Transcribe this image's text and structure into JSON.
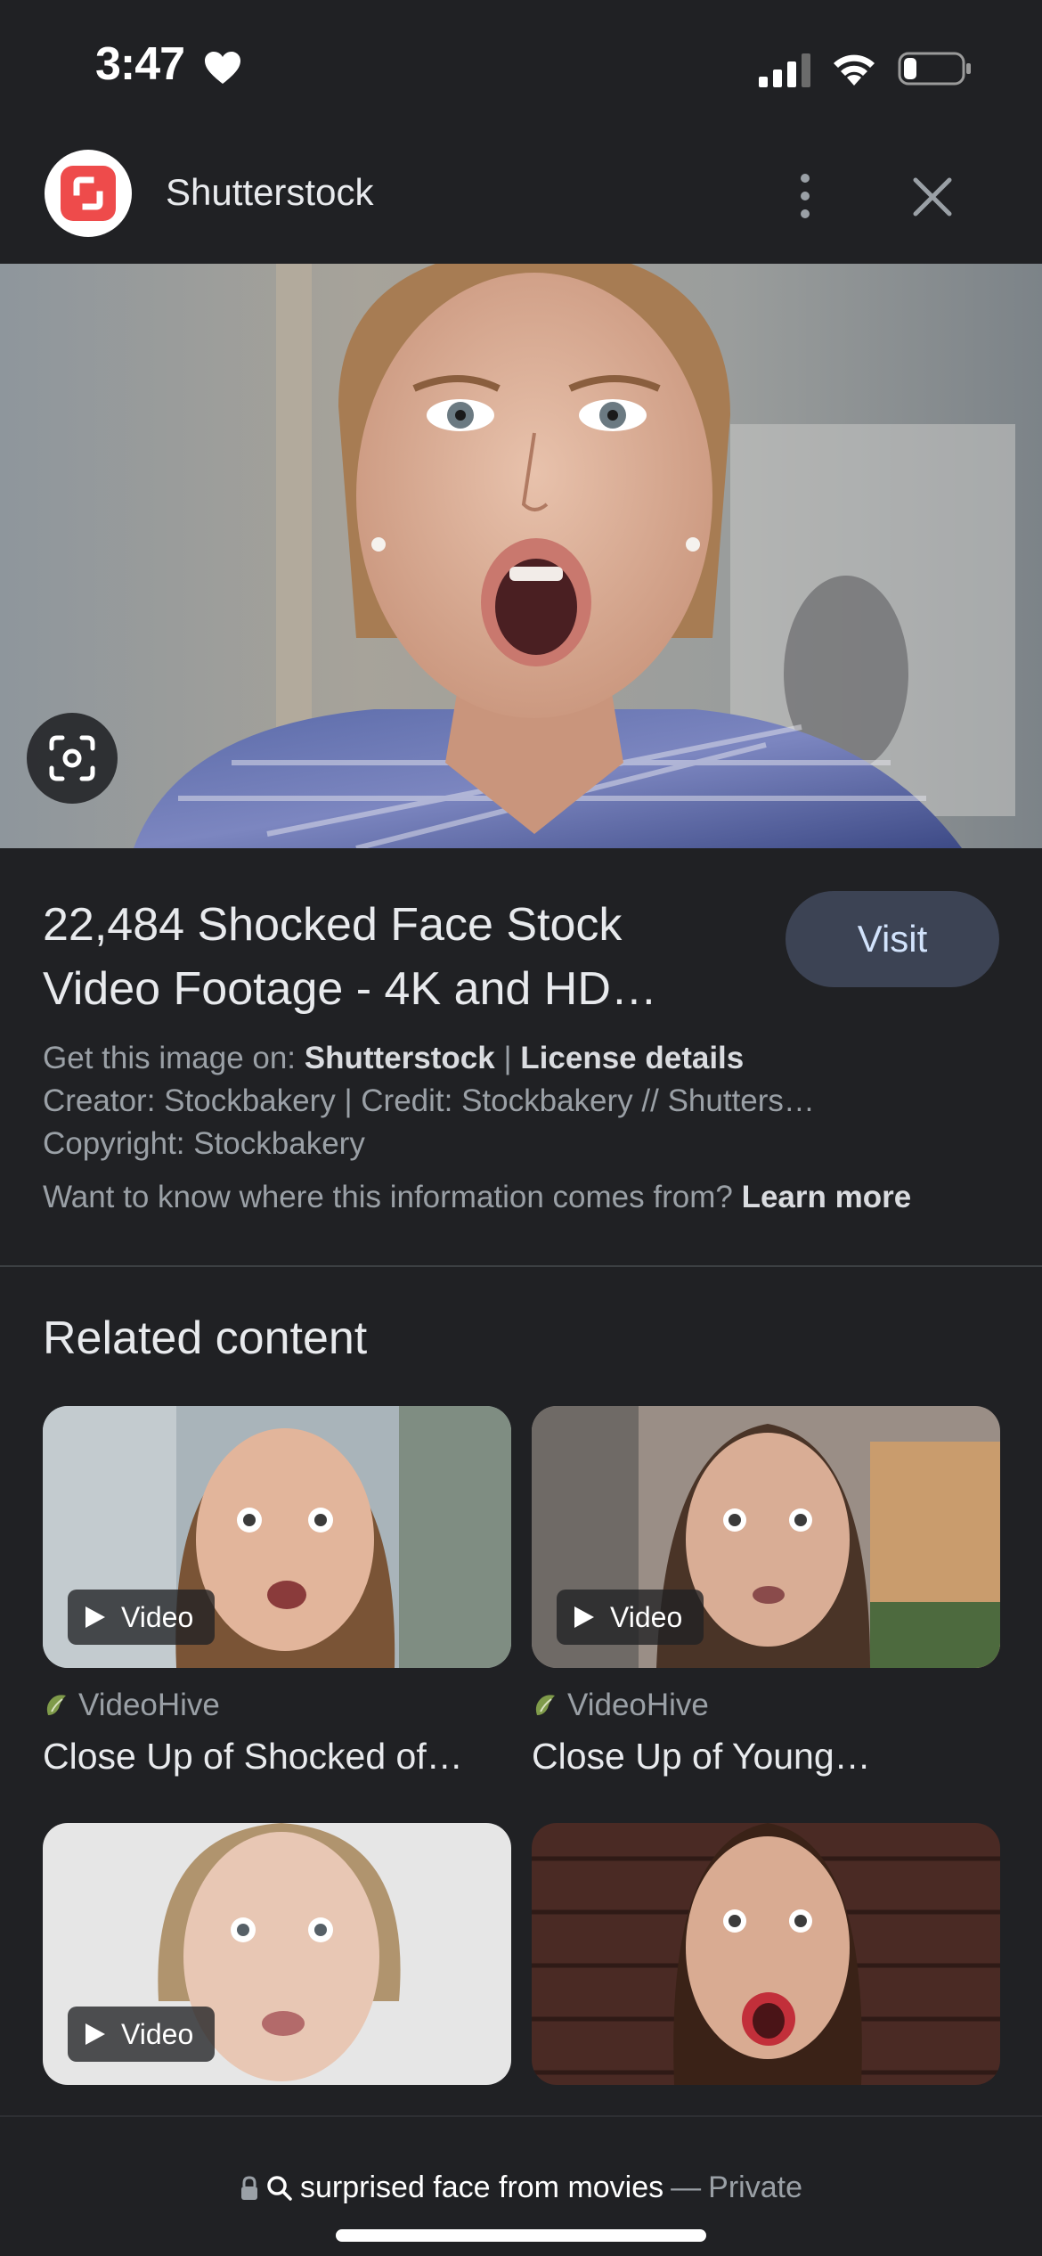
{
  "status_bar": {
    "time": "3:47",
    "icons": [
      "heart-icon",
      "cellular-signal-icon",
      "wifi-icon",
      "battery-icon"
    ]
  },
  "header": {
    "source_name": "Shutterstock",
    "logo_icon": "shutterstock-logo",
    "more_icon": "more-vertical-icon",
    "close_icon": "close-icon"
  },
  "result": {
    "title_line1": "22,484 Shocked Face Stock",
    "title_line2": "Video Footage - 4K and HD…",
    "visit_label": "Visit",
    "get_image_prefix": "Get this image on:",
    "get_image_source": "Shutterstock",
    "separator": "|",
    "license_label": "License details",
    "creator_line": "Creator: Stockbakery | Credit: Stockbakery // Shutters…",
    "copyright_line": "Copyright: Stockbakery",
    "info_question": "Want to know where this information comes from?",
    "learn_more_label": "Learn more"
  },
  "related": {
    "heading": "Related content",
    "items": [
      {
        "badge": "Video",
        "source": "VideoHive",
        "title": "Close Up of Shocked of…"
      },
      {
        "badge": "Video",
        "source": "VideoHive",
        "title": "Close Up of Young…"
      },
      {
        "badge": "Video",
        "source": "",
        "title": ""
      },
      {
        "badge": "",
        "source": "",
        "title": ""
      }
    ]
  },
  "bottom_bar": {
    "query": "surprised face from movies",
    "dash": "—",
    "mode": "Private"
  },
  "colors": {
    "background": "#202124",
    "visit_button_bg": "#3c4354",
    "visit_button_text": "#d2e3fc",
    "brand_red": "#ee4b4b"
  }
}
